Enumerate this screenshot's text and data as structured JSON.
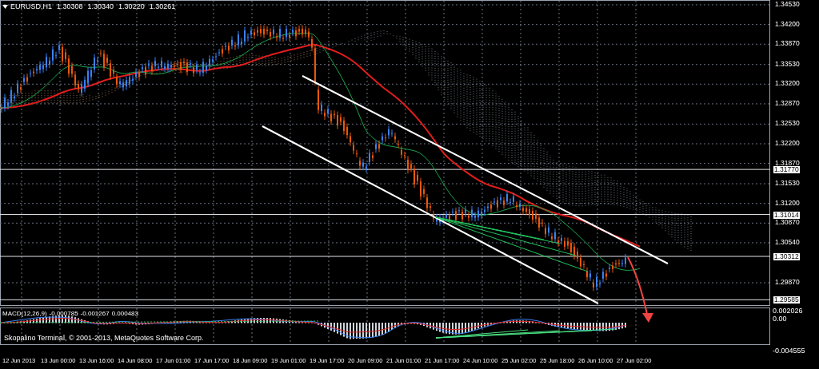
{
  "chart": {
    "symbol": "EURUSD,H1",
    "ohlc": [
      "1.30308",
      "1.30340",
      "1.30220",
      "1.30261"
    ],
    "copyright": "Skopalino Terminal, © 2001-2013, MetaQuotes Software Corp.",
    "price_axis": [
      {
        "label": "1.34530",
        "kind": "tick"
      },
      {
        "label": "1.34200",
        "kind": "tick"
      },
      {
        "label": "1.33870",
        "kind": "tick"
      },
      {
        "label": "1.33530",
        "kind": "tick"
      },
      {
        "label": "1.33200",
        "kind": "tick"
      },
      {
        "label": "1.32870",
        "kind": "tick"
      },
      {
        "label": "1.32530",
        "kind": "tick"
      },
      {
        "label": "1.32200",
        "kind": "tick"
      },
      {
        "label": "1.31870",
        "kind": "tick"
      },
      {
        "label": "1.31770",
        "kind": "level"
      },
      {
        "label": "1.31530",
        "kind": "tick"
      },
      {
        "label": "1.31200",
        "kind": "tick"
      },
      {
        "label": "1.31014",
        "kind": "level"
      },
      {
        "label": "1.30870",
        "kind": "tick"
      },
      {
        "label": "1.30540",
        "kind": "tick"
      },
      {
        "label": "1.30312",
        "kind": "level"
      },
      {
        "label": "1.29870",
        "kind": "tick"
      },
      {
        "label": "1.29585",
        "kind": "level"
      }
    ],
    "time_axis": [
      "12 Jun 2013",
      "13 Jun 00:00",
      "13 Jun 16:00",
      "14 Jun 08:00",
      "17 Jun 01:00",
      "17 Jun 17:00",
      "18 Jun 09:00",
      "19 Jun 01:00",
      "19 Jun 17:00",
      "20 Jun 09:00",
      "21 Jun 01:00",
      "21 Jun 17:00",
      "24 Jun 10:00",
      "25 Jun 02:00",
      "25 Jun 18:00",
      "26 Jun 10:00",
      "27 Jun 02:00"
    ]
  },
  "indicator": {
    "title": "MACD(12,26,9)",
    "values": [
      "-0.000785",
      "-0.001267",
      "0.000483"
    ],
    "axis": [
      "0.002026",
      "0.00",
      "-0.004555"
    ]
  }
}
